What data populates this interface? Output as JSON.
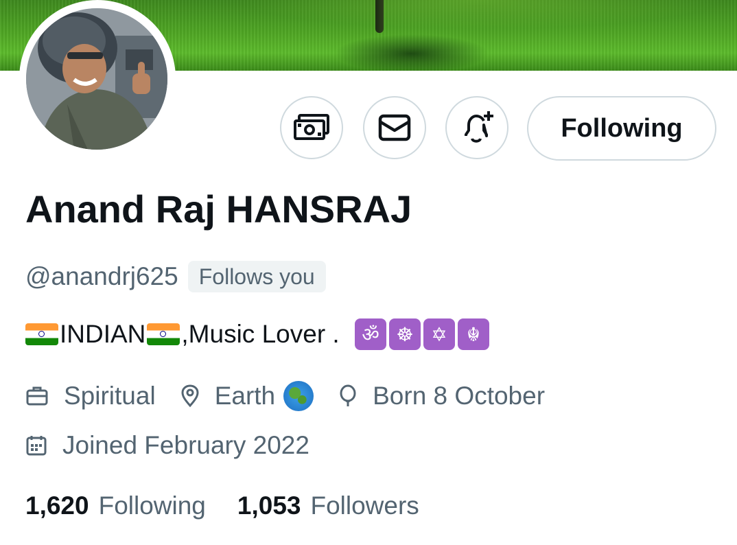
{
  "profile": {
    "display_name": "Anand Raj HANSRAJ",
    "handle": "@anandrj625",
    "follows_you_badge": "Follows you",
    "bio": {
      "text_indian": "INDIAN",
      "text_music": ",Music Lover . ",
      "symbols": [
        "ॐ",
        "☸",
        "✡",
        "☬"
      ]
    },
    "meta": {
      "category": "Spiritual",
      "location": "Earth",
      "birthday": "Born 8 October",
      "joined": "Joined February 2022"
    },
    "stats": {
      "following_count": "1,620",
      "following_label": "Following",
      "followers_count": "1,053",
      "followers_label": "Followers"
    }
  },
  "actions": {
    "tip_icon": "money-icon",
    "message_icon": "mail-icon",
    "notify_icon": "bell-plus-icon",
    "follow_label": "Following"
  },
  "colors": {
    "text_primary": "#0f1419",
    "text_secondary": "#536471",
    "border": "#cfd9de",
    "badge_bg": "#eff3f4",
    "symbol_bg": "#a05fc8"
  }
}
